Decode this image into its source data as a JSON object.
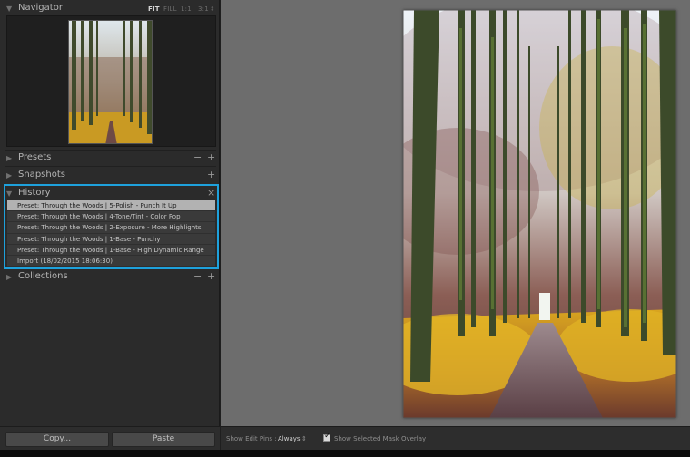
{
  "navigator": {
    "title": "Navigator",
    "zoom_options": [
      "FIT",
      "FILL",
      "1:1",
      "3:1"
    ],
    "zoom_selected": "FIT"
  },
  "panels": {
    "presets": "Presets",
    "snapshots": "Snapshots",
    "history": "History",
    "collections": "Collections"
  },
  "history": {
    "items": [
      "Preset: Through the Woods | 5-Polish - Punch It Up",
      "Preset: Through the Woods | 4-Tone/Tint - Color Pop",
      "Preset: Through the Woods | 2-Exposure - More Highlights",
      "Preset: Through the Woods | 1-Base - Punchy",
      "Preset: Through the Woods | 1-Base - High Dynamic Range",
      "Import (18/02/2015 18:06:30)"
    ],
    "selected_index": 0
  },
  "buttons": {
    "copy": "Copy...",
    "paste": "Paste"
  },
  "toolbar": {
    "edit_pins_label": "Show Edit Pins :",
    "edit_pins_value": "Always",
    "mask_overlay_label": "Show Selected Mask Overlay",
    "mask_overlay_checked": true
  },
  "colors": {
    "accent": "#1ea1dc",
    "panel_bg": "#2b2b2b",
    "canvas_bg": "#6d6d6d"
  },
  "icons": [
    "collapse-triangle-icon",
    "expand-triangle-icon",
    "plus-icon",
    "minus-icon",
    "close-icon",
    "checkmark-icon",
    "updown-arrows-icon"
  ]
}
